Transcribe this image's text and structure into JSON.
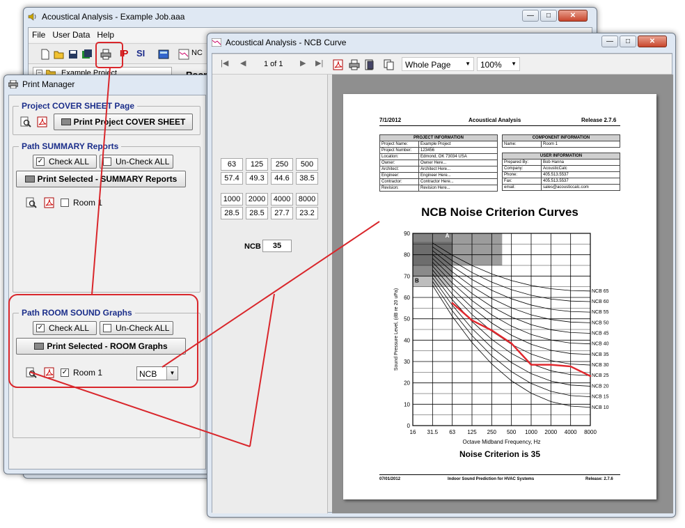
{
  "main_window": {
    "title": "Acoustical Analysis - Example Job.aaa",
    "menu": [
      "File",
      "User Data",
      "Help"
    ],
    "toolbar_text": [
      "IP",
      "SI",
      "NC"
    ],
    "tree_item": "Example Project",
    "partial_label": "Room"
  },
  "print_manager": {
    "title": "Print Manager",
    "cover": {
      "title": "Project COVER SHEET Page",
      "print_label": "Print Project COVER SHEET"
    },
    "summary": {
      "title": "Path SUMMARY Reports",
      "check_all": "Check ALL",
      "uncheck_all": "Un-Check ALL",
      "print_label": "Print Selected - SUMMARY Reports",
      "room_label": "Room 1"
    },
    "room_sound": {
      "title": "Path ROOM SOUND Graphs",
      "check_all": "Check ALL",
      "uncheck_all": "Un-Check ALL",
      "print_label": "Print Selected - ROOM Graphs",
      "room_label": "Room 1",
      "graph_type": "NCB"
    }
  },
  "ncb_window": {
    "title": "Acoustical Analysis - NCB Curve",
    "page_indicator": "1 of 1",
    "zoom_mode": "Whole Page",
    "zoom_percent": "100%",
    "bands_row1": [
      {
        "freq": "63",
        "val": "57.4"
      },
      {
        "freq": "125",
        "val": "49.3"
      },
      {
        "freq": "250",
        "val": "44.6"
      },
      {
        "freq": "500",
        "val": "38.5"
      }
    ],
    "bands_row2": [
      {
        "freq": "1000",
        "val": "28.5"
      },
      {
        "freq": "2000",
        "val": "28.5"
      },
      {
        "freq": "4000",
        "val": "27.7"
      },
      {
        "freq": "8000",
        "val": "23.2"
      }
    ],
    "ncb_label": "NCB",
    "ncb_value": "35"
  },
  "report": {
    "date": "7/1/2012",
    "app": "Acoustical Analysis",
    "release": "Release 2.7.6",
    "project_header": "PROJECT INFORMATION",
    "project_info": [
      [
        "Project Name:",
        "Example Project"
      ],
      [
        "Project Number:",
        "123456"
      ],
      [
        "Location:",
        "Edmond, OK 73034 USA"
      ],
      [
        "Owner:",
        "Owner Here..."
      ],
      [
        "Architect:",
        "Architect Here..."
      ],
      [
        "Engineer:",
        "Engineer Here..."
      ],
      [
        "Contractor:",
        "Contractor Here..."
      ],
      [
        "Revision:",
        "Revision Here..."
      ]
    ],
    "component_header": "COMPONENT INFORMATION",
    "component_info": [
      [
        "Name:",
        "Room 1"
      ]
    ],
    "user_header": "USER INFORMATION",
    "user_info": [
      [
        "Prepared By:",
        "Bob Hanna"
      ],
      [
        "Company:",
        "AcousticCalc"
      ],
      [
        "Phone:",
        "405.513.5537"
      ],
      [
        "Fax:",
        "405.513.5537"
      ],
      [
        "email:",
        "sales@acousticcalc.com"
      ]
    ],
    "chart_title": "NCB Noise Criterion Curves",
    "result": "Noise Criterion is 35",
    "footer_left": "07/01/2012",
    "footer_mid": "Indoor Sound Prediction for HVAC Systems",
    "footer_right": "Release: 2.7.6"
  },
  "chart_data": {
    "type": "line",
    "title": "NCB Noise Criterion Curves",
    "xlabel": "Octave Midband Frequency, Hz",
    "ylabel": "Sound Pressure Level, (dB re 20 uPa)",
    "x": [
      "16",
      "31.5",
      "63",
      "125",
      "250",
      "500",
      "1000",
      "2000",
      "4000",
      "8000"
    ],
    "ylim": [
      0,
      90
    ],
    "yticks": [
      "90",
      "80",
      "70",
      "60",
      "50",
      "40",
      "30",
      "20",
      "10",
      "0"
    ],
    "grid": true,
    "region_labels": [
      "A",
      "B"
    ],
    "curve_labels": [
      "NCB 65",
      "NCB 60",
      "NCB 55",
      "NCB 50",
      "NCB 45",
      "NCB 40",
      "NCB 35",
      "NCB 30",
      "NCB 25",
      "NCB 20",
      "NCB 15",
      "NCB 10"
    ],
    "measured": {
      "x": [
        "63",
        "125",
        "250",
        "500",
        "1000",
        "2000",
        "4000",
        "8000"
      ],
      "values": [
        57.4,
        49.3,
        44.6,
        38.5,
        28.5,
        28.5,
        27.7,
        23.2
      ],
      "color": "#e0282e"
    },
    "accent_color": "#d9262b"
  }
}
